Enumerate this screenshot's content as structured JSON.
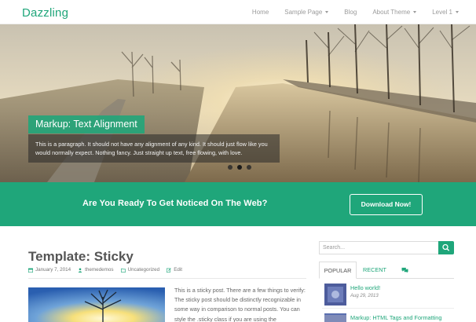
{
  "brand": {
    "name": "Dazzling"
  },
  "nav": {
    "items": [
      {
        "label": "Home",
        "has_caret": false
      },
      {
        "label": "Sample Page",
        "has_caret": true
      },
      {
        "label": "Blog",
        "has_caret": false
      },
      {
        "label": "About Theme",
        "has_caret": true
      },
      {
        "label": "Level 1",
        "has_caret": true
      }
    ]
  },
  "hero": {
    "title": "Markup: Text Alignment",
    "caption": "This is a paragraph. It should not have any alignment of any kind. It should just flow like you would normally expect. Nothing fancy. Just straight up text, free flowing, with love.",
    "slides": 3,
    "active_slide": 2
  },
  "cta": {
    "text": "Are You Ready To Get Noticed On The Web?",
    "button_label": "Download Now!"
  },
  "post": {
    "title": "Template: Sticky",
    "date": "January 7, 2014",
    "author": "themedemos",
    "category": "Uncategorized",
    "edit_label": "Edit",
    "excerpt": "This is a sticky post. There are a few things to verify: The sticky post should be distinctly recognizable in some way in comparison to normal posts. You can style the .sticky class if you are using the"
  },
  "sidebar": {
    "search_placeholder": "Search...",
    "tabs": {
      "popular": "POPULAR",
      "recent": "RECENT",
      "comments_icon": "comments-icon"
    },
    "items": [
      {
        "title": "Hello world!",
        "date": "Aug 29, 2013"
      },
      {
        "title": "Markup: HTML Tags and Formatting",
        "date": ""
      }
    ]
  },
  "colors": {
    "accent": "#1fa67a"
  }
}
